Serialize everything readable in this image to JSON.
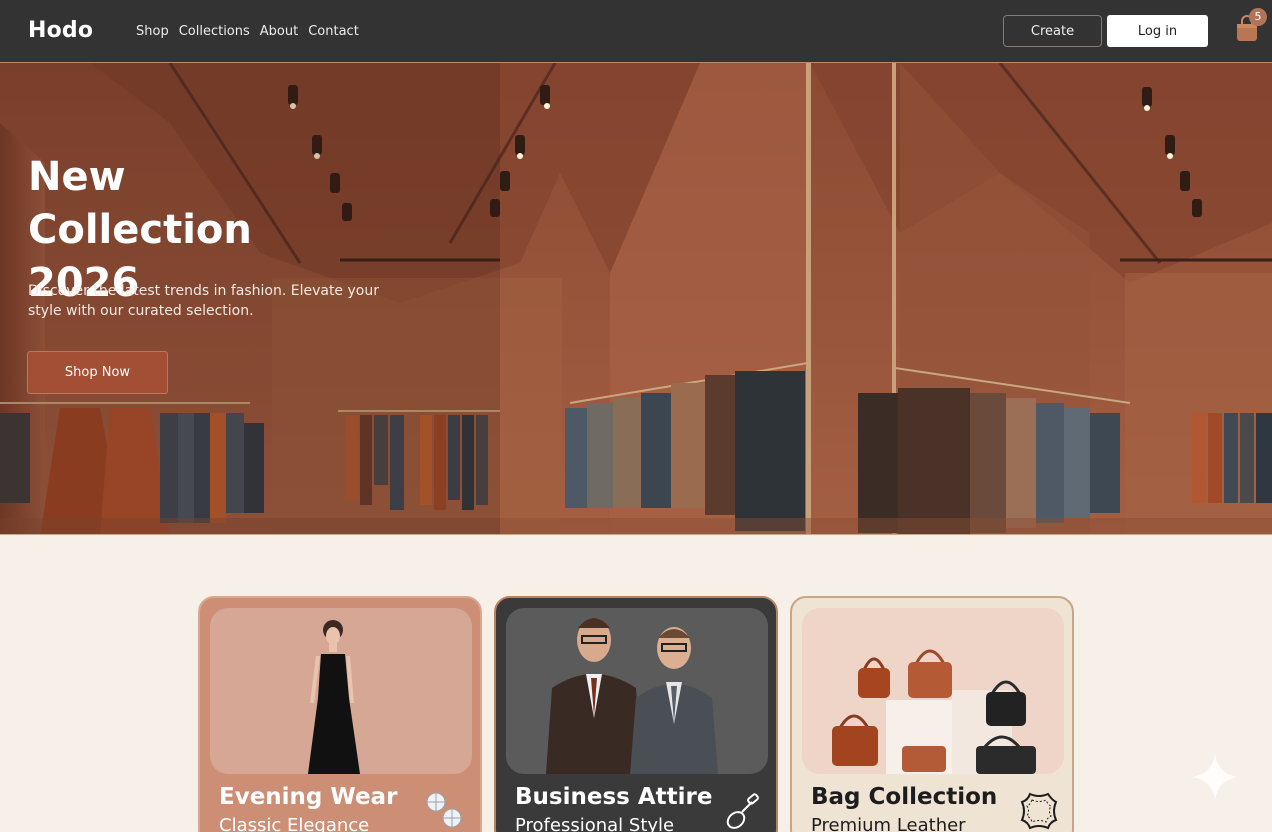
{
  "brand": {
    "logo": "Hodo",
    "accent": "#a24f35",
    "nav_bg": "#333333"
  },
  "nav": {
    "links": [
      "Shop",
      "Collections",
      "About",
      "Contact"
    ],
    "create_label": "Create",
    "login_label": "Log in",
    "cart_count": "5",
    "cart_icon": "shopping-bag-icon"
  },
  "hero": {
    "title": "New Collection 2026",
    "subtitle": "Discover the latest trends in fashion. Elevate your style with our curated selection.",
    "cta_label": "Shop Now"
  },
  "collections": [
    {
      "title": "Evening Wear",
      "subtitle": "Classic Elegance",
      "icon": "diamond-icon"
    },
    {
      "title": "Business Attire",
      "subtitle": "Professional Style",
      "icon": "cufflink-icon"
    },
    {
      "title": "Bag Collection",
      "subtitle": "Premium Leather",
      "icon": "leather-hide-icon"
    }
  ]
}
